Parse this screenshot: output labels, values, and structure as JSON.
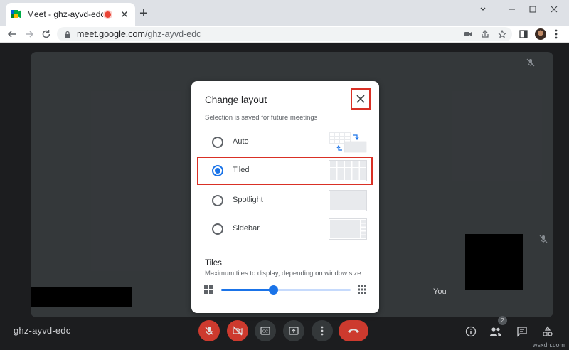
{
  "browser": {
    "tab_title": "Meet - ghz-ayvd-edc",
    "url_host": "meet.google.com",
    "url_path": "/ghz-ayvd-edc",
    "new_tab_symbol": "+"
  },
  "meet": {
    "meeting_code": "ghz-ayvd-edc",
    "self_label": "You",
    "participants_count": "2",
    "colors": {
      "end_call": "#ea4335",
      "muted": "#ea4335",
      "control_bg": "#3c4043"
    }
  },
  "dialog": {
    "title": "Change layout",
    "subtitle": "Selection is saved for future meetings",
    "options": [
      {
        "label": "Auto",
        "selected": false
      },
      {
        "label": "Tiled",
        "selected": true
      },
      {
        "label": "Spotlight",
        "selected": false
      },
      {
        "label": "Sidebar",
        "selected": false
      }
    ],
    "tiles_title": "Tiles",
    "tiles_subtitle": "Maximum tiles to display, depending on window size.",
    "tiles_slider_fraction": 0.4,
    "accent": "#1a73e8",
    "highlight": "#d93025"
  },
  "watermark": "wsxdn.com"
}
